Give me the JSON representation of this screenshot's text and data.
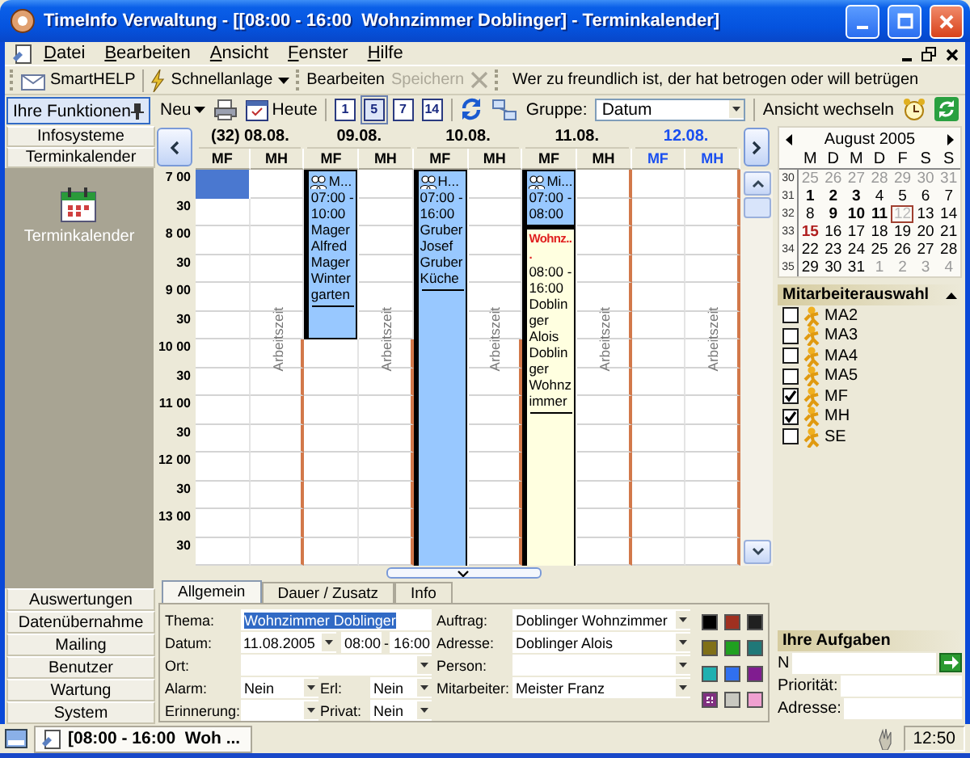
{
  "window": {
    "title": "TimeInfo Verwaltung - [[08:00 - 16:00  Wohnzimmer Doblinger] - Terminkalender]"
  },
  "menu": [
    "Datei",
    "Bearbeiten",
    "Ansicht",
    "Fenster",
    "Hilfe"
  ],
  "toolbar": {
    "smarthelp": "SmartHELP",
    "quick_create": "Schnellanlage",
    "edit": {
      "label": "Bearbeiten",
      "disabled": false
    },
    "save": {
      "label": "Speichern",
      "disabled": true
    },
    "cancel": {
      "disabled": true
    },
    "motto": "Wer zu freundlich ist, der hat betrogen oder will betrügen"
  },
  "functions_panel": {
    "title": "Ihre Funktionen",
    "top_items": [
      "Infosysteme",
      "Terminkalender"
    ],
    "shortcuts": [
      "Terminkalender"
    ],
    "bottom_items": [
      "Auswertungen",
      "Datenübernahme",
      "Mailing",
      "Benutzer",
      "Wartung",
      "System"
    ]
  },
  "calendar_toolbar": {
    "new": "Neu",
    "today": "Heute",
    "views": [
      {
        "label": "1",
        "selected": false
      },
      {
        "label": "5",
        "selected": true
      },
      {
        "label": "7",
        "selected": false
      },
      {
        "label": "14",
        "selected": false
      }
    ],
    "group_label": "Gruppe:",
    "group_value": "Datum",
    "switch_view": "Ansicht wechseln"
  },
  "calendar": {
    "times": [
      "7 00",
      "30",
      "8 00",
      "30",
      "9 00",
      "30",
      "10 00",
      "30",
      "11 00",
      "30",
      "12 00",
      "30",
      "13 00",
      "30"
    ],
    "days": [
      {
        "label": "(32) 08.08.",
        "highlighted": false,
        "columns": [
          {
            "label": "MF",
            "selection": true
          },
          {
            "label": "MH",
            "work_time_label": "Arbeitszeit"
          }
        ]
      },
      {
        "label": "09.08.",
        "highlighted": false,
        "columns": [
          {
            "label": "MF",
            "events": [
              {
                "kind": "appointment",
                "title": "M...",
                "start": "07:00",
                "separator": "-",
                "end": "10:00",
                "text": "Mager Alfred Mager Wintergarten"
              }
            ]
          },
          {
            "label": "MH",
            "work_time_label": "Arbeitszeit"
          }
        ]
      },
      {
        "label": "10.08.",
        "highlighted": false,
        "columns": [
          {
            "label": "MF",
            "events": [
              {
                "kind": "appointment",
                "title": "H...",
                "start": "07:00",
                "separator": "-",
                "end": "16:00",
                "text": "Gruber Josef Gruber Küche"
              }
            ]
          },
          {
            "label": "MH",
            "work_time_label": "Arbeitszeit"
          }
        ]
      },
      {
        "label": "11.08.",
        "highlighted": false,
        "columns": [
          {
            "label": "MF",
            "events": [
              {
                "kind": "appointment",
                "title": "Mi...",
                "start": "07:00",
                "separator": "-",
                "end": "08:00"
              },
              {
                "kind": "task",
                "title": "Wohnz...",
                "start": "08:00",
                "separator": "-",
                "end": "16:00",
                "text": "Doblinger Alois Doblinger Wohnzimmer"
              }
            ]
          },
          {
            "label": "MH",
            "work_time_label": "Arbeitszeit"
          }
        ]
      },
      {
        "label": "12.08.",
        "highlighted": true,
        "columns": [
          {
            "label": "MF"
          },
          {
            "label": "MH",
            "work_time_label": "Arbeitszeit"
          }
        ]
      }
    ]
  },
  "appointment_form": {
    "tabs": [
      {
        "label": "Allgemein",
        "selected": true
      },
      {
        "label": "Dauer / Zusatz",
        "selected": false
      },
      {
        "label": "Info",
        "selected": false
      }
    ],
    "thema": {
      "label": "Thema:",
      "value": "Wohnzimmer Doblinger",
      "text_selected": true
    },
    "datum": {
      "label": "Datum:",
      "value": "11.08.2005",
      "start": "08:00",
      "separator": "-",
      "end": "16:00"
    },
    "ort": {
      "label": "Ort:"
    },
    "alarm": {
      "label": "Alarm:",
      "value": "Nein"
    },
    "erl": {
      "label": "Erl:",
      "value": "Nein"
    },
    "erinnerung": {
      "label": "Erinnerung:"
    },
    "privat": {
      "label": "Privat:",
      "value": "Nein"
    },
    "auftrag": {
      "label": "Auftrag:",
      "value": "Doblinger Wohnzimmer"
    },
    "adresse": {
      "label": "Adresse:",
      "value": "Doblinger Alois"
    },
    "person": {
      "label": "Person:"
    },
    "mitarbeiter": {
      "label": "Mitarbeiter:",
      "value": "Meister Franz"
    },
    "colors": [
      {
        "color": "#000000",
        "selected": false
      },
      {
        "color": "#a03020",
        "selected": false
      },
      {
        "color": "#202020",
        "selected": false
      },
      {
        "color": "#807018",
        "selected": false
      },
      {
        "color": "#20a020",
        "selected": false
      },
      {
        "color": "#207878",
        "selected": false
      },
      {
        "color": "#20b0b0",
        "selected": false
      },
      {
        "color": "#3070f0",
        "selected": false
      },
      {
        "color": "#801c90",
        "selected": false
      },
      {
        "color": "#803080",
        "selected": true
      },
      {
        "color": "#c8c8c0",
        "selected": false
      },
      {
        "color": "#f0a0d0",
        "selected": false
      }
    ]
  },
  "month_calendar": {
    "title": "August 2005",
    "weekdays": [
      "M",
      "D",
      "M",
      "D",
      "F",
      "S",
      "S"
    ],
    "weeks": [
      {
        "number": "30",
        "days": [
          {
            "label": "25",
            "kind": "other",
            "selected": false
          },
          {
            "label": "26",
            "kind": "other",
            "selected": false
          },
          {
            "label": "27",
            "kind": "other",
            "selected": false
          },
          {
            "label": "28",
            "kind": "other",
            "selected": false
          },
          {
            "label": "29",
            "kind": "other",
            "selected": false
          },
          {
            "label": "30",
            "kind": "other",
            "selected": false
          },
          {
            "label": "31",
            "kind": "other",
            "selected": false
          }
        ]
      },
      {
        "number": "31",
        "days": [
          {
            "label": "1",
            "kind": "busy",
            "selected": false
          },
          {
            "label": "2",
            "kind": "busy",
            "selected": false
          },
          {
            "label": "3",
            "kind": "busy",
            "selected": false
          },
          {
            "label": "4",
            "kind": "plain",
            "selected": false
          },
          {
            "label": "5",
            "kind": "plain",
            "selected": false
          },
          {
            "label": "6",
            "kind": "plain",
            "selected": false
          },
          {
            "label": "7",
            "kind": "plain",
            "selected": false
          }
        ]
      },
      {
        "number": "32",
        "days": [
          {
            "label": "8",
            "kind": "plain",
            "selected": false
          },
          {
            "label": "9",
            "kind": "busy",
            "selected": false
          },
          {
            "label": "10",
            "kind": "busy",
            "selected": false
          },
          {
            "label": "11",
            "kind": "busy",
            "selected": false
          },
          {
            "label": "12",
            "kind": "plain",
            "selected": true
          },
          {
            "label": "13",
            "kind": "plain",
            "selected": false
          },
          {
            "label": "14",
            "kind": "plain",
            "selected": false
          }
        ]
      },
      {
        "number": "33",
        "days": [
          {
            "label": "15",
            "kind": "today",
            "selected": false
          },
          {
            "label": "16",
            "kind": "plain",
            "selected": false
          },
          {
            "label": "17",
            "kind": "plain",
            "selected": false
          },
          {
            "label": "18",
            "kind": "plain",
            "selected": false
          },
          {
            "label": "19",
            "kind": "plain",
            "selected": false
          },
          {
            "label": "20",
            "kind": "plain",
            "selected": false
          },
          {
            "label": "21",
            "kind": "plain",
            "selected": false
          }
        ]
      },
      {
        "number": "34",
        "days": [
          {
            "label": "22",
            "kind": "plain",
            "selected": false
          },
          {
            "label": "23",
            "kind": "plain",
            "selected": false
          },
          {
            "label": "24",
            "kind": "plain",
            "selected": false
          },
          {
            "label": "25",
            "kind": "plain",
            "selected": false
          },
          {
            "label": "26",
            "kind": "plain",
            "selected": false
          },
          {
            "label": "27",
            "kind": "plain",
            "selected": false
          },
          {
            "label": "28",
            "kind": "plain",
            "selected": false
          }
        ]
      },
      {
        "number": "35",
        "days": [
          {
            "label": "29",
            "kind": "plain",
            "selected": false
          },
          {
            "label": "30",
            "kind": "plain",
            "selected": false
          },
          {
            "label": "31",
            "kind": "plain",
            "selected": false
          },
          {
            "label": "1",
            "kind": "other",
            "selected": false
          },
          {
            "label": "2",
            "kind": "other",
            "selected": false
          },
          {
            "label": "3",
            "kind": "other",
            "selected": false
          },
          {
            "label": "4",
            "kind": "other",
            "selected": false
          }
        ]
      }
    ]
  },
  "staff_panel": {
    "title": "Mitarbeiterauswahl",
    "items": [
      {
        "label": "MA2",
        "checked": false
      },
      {
        "label": "MA3",
        "checked": false
      },
      {
        "label": "MA4",
        "checked": false
      },
      {
        "label": "MA5",
        "checked": false
      },
      {
        "label": "MF",
        "checked": true
      },
      {
        "label": "MH",
        "checked": true
      },
      {
        "label": "SE",
        "checked": false
      }
    ]
  },
  "tasks_panel": {
    "title": "Ihre Aufgaben",
    "fields": [
      {
        "label": "N",
        "kind": "go"
      },
      {
        "label": "Priorität:",
        "kind": "plain"
      },
      {
        "label": "Adresse:",
        "kind": "plain"
      }
    ]
  },
  "taskbar": {
    "task": "[08:00 - 16:00  Woh ...",
    "clock": "12:50"
  }
}
